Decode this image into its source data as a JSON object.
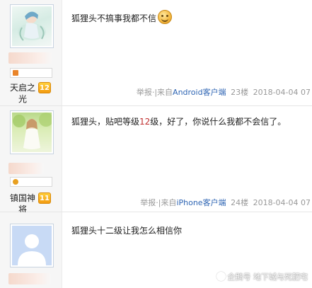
{
  "posts": [
    {
      "rank_label": "天启之光",
      "level": "12",
      "content": "狐狸头不搞事我都不信",
      "emoji": "smiley-icon",
      "report": "举报",
      "separator": "·|",
      "from": "来自",
      "client": "Android客户端",
      "floor": "23楼",
      "date": "2018-04-04 07"
    },
    {
      "rank_label": "镇国神将",
      "level": "11",
      "content_before": "狐狸头，贴吧等级",
      "content_highlight": "12",
      "content_after": "级，好了，你说什么我都不会信了。",
      "report": "举报",
      "separator": "·|",
      "from": "来自",
      "client": "iPhone客户端",
      "floor": "24楼",
      "date": "2018-04-04 07"
    },
    {
      "content": "狐狸头十二级让我怎么相信你"
    }
  ],
  "watermark": "企鹅号 地下城与死肥宅",
  "colors": {
    "client_link": "#2d64b3",
    "level_badge": "#f39b10",
    "meta_gray": "#999999"
  }
}
